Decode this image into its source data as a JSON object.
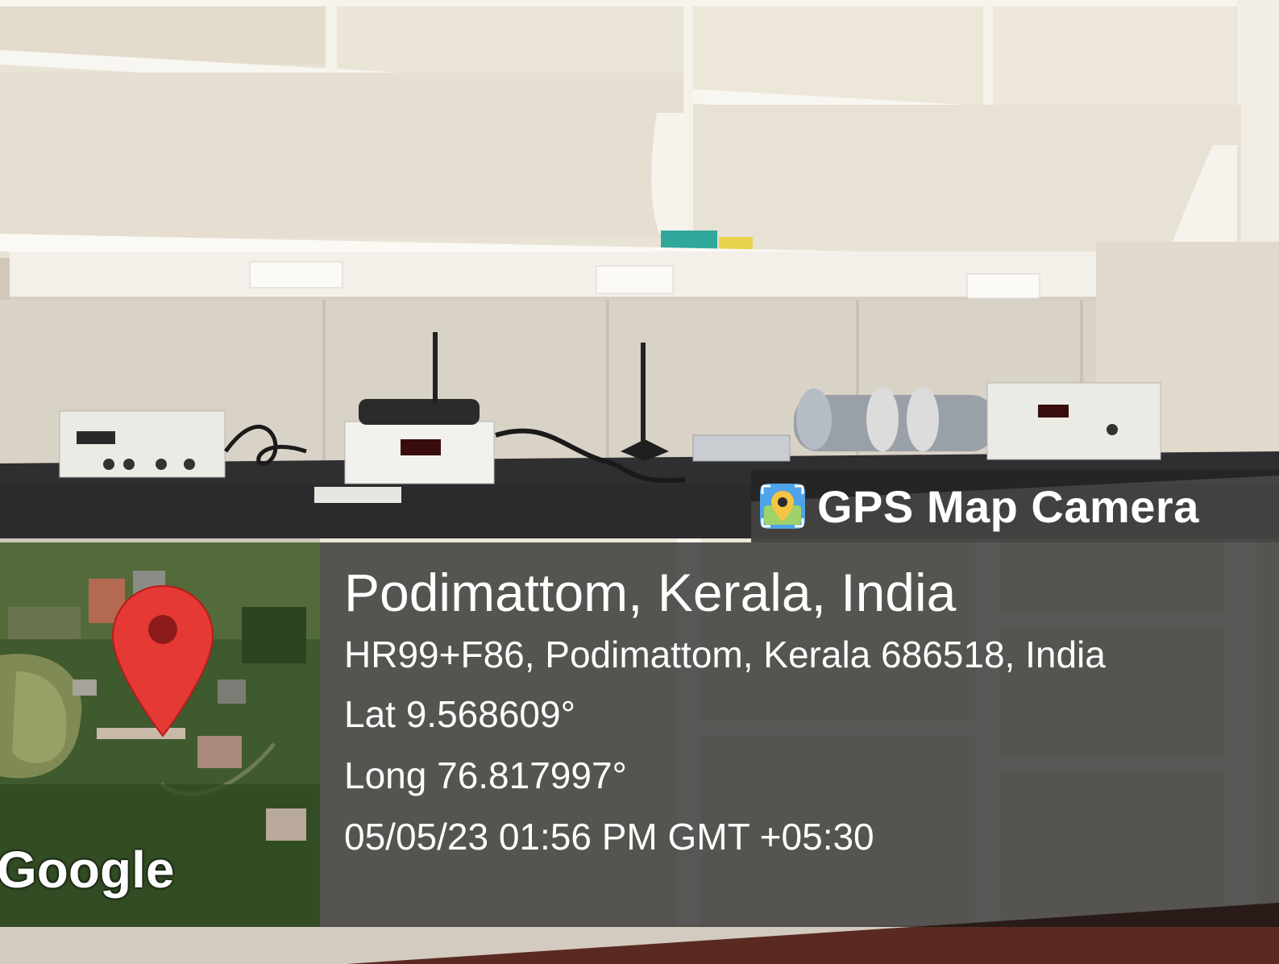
{
  "overlay": {
    "app_name": "GPS Map Camera",
    "app_icon": "gps-map-camera-icon",
    "location_title": "Podimattom, Kerala, India",
    "address": "HR99+F86, Podimattom, Kerala 686518, India",
    "latitude": "Lat 9.568609°",
    "longitude": "Long 76.817997°",
    "timestamp": "05/05/23 01:56 PM GMT +05:30"
  },
  "map": {
    "provider_mark": "Google",
    "pin_icon": "map-pin-icon",
    "pin_color": "#e53935"
  },
  "colors": {
    "panel_background": "#1a1a1a",
    "text": "#ffffff"
  }
}
